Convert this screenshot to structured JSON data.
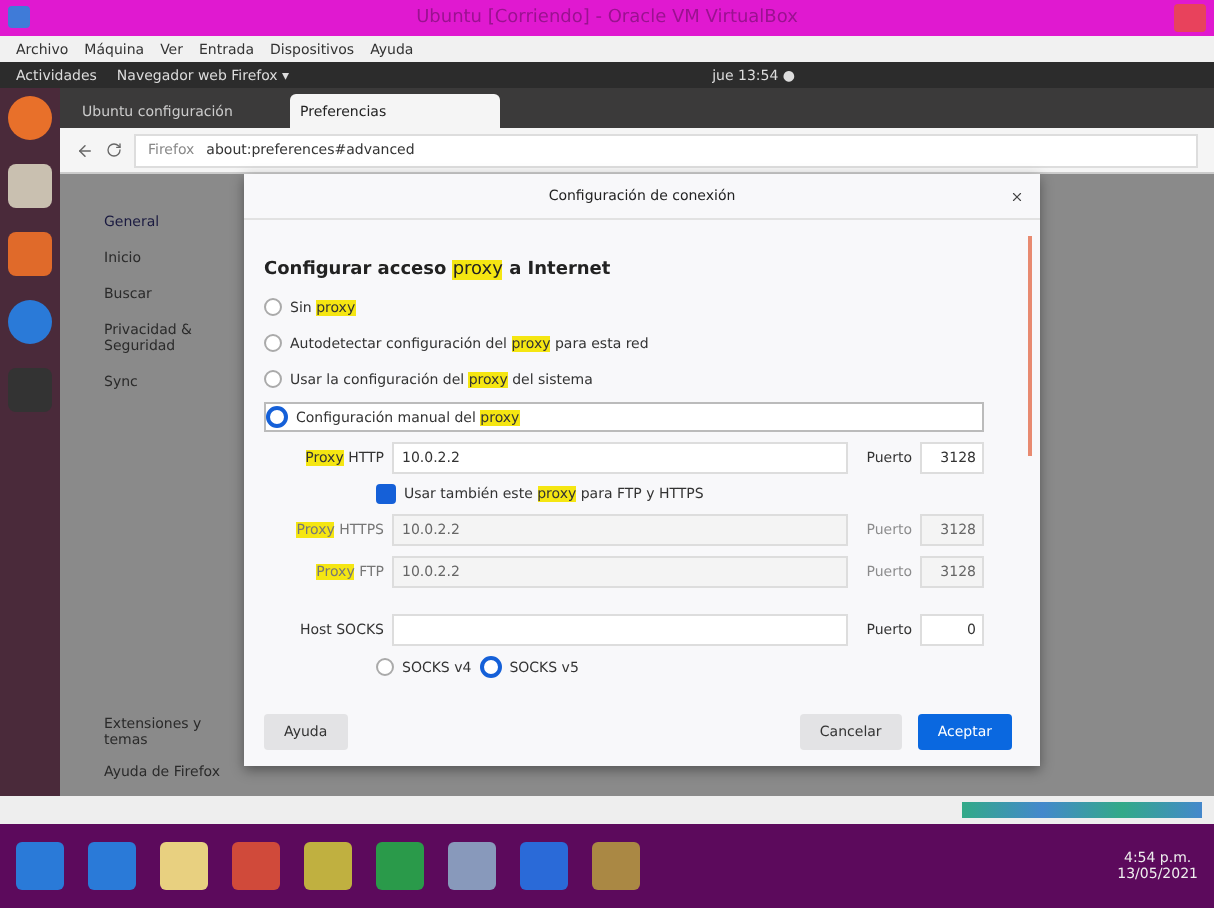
{
  "window": {
    "title": "Ubuntu [Corriendo] - Oracle VM VirtualBox"
  },
  "vm_menu": [
    "Archivo",
    "Máquina",
    "Ver",
    "Entrada",
    "Dispositivos",
    "Ayuda"
  ],
  "top_bar": {
    "activities": "Actividades",
    "app": "Navegador web Firefox ▾",
    "clock": "jue 13:54 ●"
  },
  "tabs": [
    {
      "label": "Ubuntu configuración",
      "selected": false
    },
    {
      "label": "Preferencias",
      "selected": true
    }
  ],
  "address": {
    "prefix": "Firefox",
    "url": "about:preferences#advanced"
  },
  "prefs_sidebar": [
    {
      "label": "General",
      "selected": true
    },
    {
      "label": "Inicio",
      "selected": false
    },
    {
      "label": "Buscar",
      "selected": false
    },
    {
      "label": "Privacidad & Seguridad",
      "selected": false
    },
    {
      "label": "Sync",
      "selected": false
    }
  ],
  "prefs_footer": [
    "Extensiones y temas",
    "Ayuda de Firefox"
  ],
  "dialog": {
    "title": "Configuración de conexión",
    "heading": "Configurar acceso **proxy** a Internet",
    "options": [
      {
        "label": "Sin **proxy**",
        "selected": false
      },
      {
        "label": "Autodetectar configuración del **proxy** para esta red",
        "selected": false
      },
      {
        "label": "Usar la configuración del **proxy** del sistema",
        "selected": false
      },
      {
        "label": "Configuración manual del **proxy**",
        "selected": true
      }
    ],
    "http": {
      "label": "**Proxy** HTTP",
      "value": "10.0.2.2",
      "port_label": "Puerto",
      "port": "3128"
    },
    "also_use": {
      "label": "Usar también este **proxy** para FTP y HTTPS",
      "checked": true
    },
    "others": [
      {
        "label": "**Proxy** HTTPS",
        "value": "10.0.2.2",
        "port_label": "Puerto",
        "port": "3128",
        "disabled": true
      },
      {
        "label": "**Proxy** FTP",
        "value": "10.0.2.2",
        "port_label": "Puerto",
        "port": "3128",
        "disabled": true
      },
      {
        "label": "Host SOCKS",
        "port_label": "Puerto",
        "port": "0",
        "disabled": false
      }
    ],
    "socks": [
      {
        "label": "SOCKS v4",
        "selected": false
      },
      {
        "label": "SOCKS v5",
        "selected": true
      }
    ],
    "buttons": {
      "help": "Ayuda",
      "cancel": "Cancelar",
      "ok": "Aceptar"
    }
  },
  "taskbar": {
    "time": "4:54 p.m.",
    "date": "13/05/2021"
  }
}
